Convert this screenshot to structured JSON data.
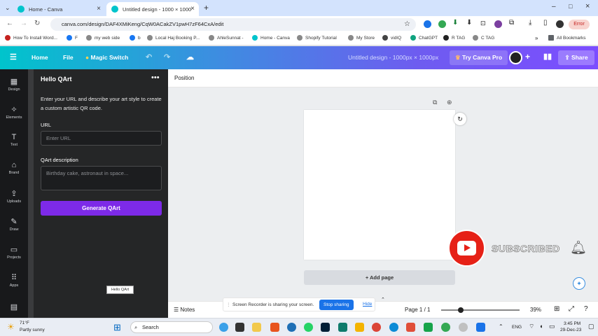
{
  "browser": {
    "tabs": [
      {
        "title": "Home - Canva",
        "active": false
      },
      {
        "title": "Untitled design - 1000 × 1000p",
        "active": true
      }
    ],
    "url": "canva.com/design/DAF4XMiKeng/CqW0ACakZV1pwH7zF64CxA/edit",
    "error_label": "Error",
    "bookmarks": [
      "How To Install Word...",
      "F",
      "my web side",
      "b",
      "Local Haj Booking P...",
      "AhleSunnat -",
      "Home - Canva",
      "Shopify Tutorial",
      "My Store",
      "vidIQ",
      "ChatGPT",
      "R TAG",
      "C TAG"
    ],
    "all_bookmarks": "All Bookmarks"
  },
  "canva": {
    "home": "Home",
    "file": "File",
    "magic_switch": "Magic Switch",
    "design_title": "Untitled design - 1000px × 1000px",
    "try_pro": "Try Canva Pro",
    "share": "Share"
  },
  "leftnav": [
    "Design",
    "Elements",
    "Text",
    "Brand",
    "Uploads",
    "Draw",
    "Projects",
    "Apps"
  ],
  "panel": {
    "title": "Hello QArt",
    "description": "Enter your URL and describe your art style to create a custom artistic QR code.",
    "url_label": "URL",
    "url_placeholder": "Enter URL",
    "desc_label": "QArt description",
    "desc_placeholder": "Birthday cake, astronaut in space...",
    "generate": "Generate QArt",
    "tooltip": "Hello QArt"
  },
  "workspace": {
    "position": "Position",
    "add_page": "+ Add page",
    "notes": "Notes",
    "page_indicator": "Page 1 / 1",
    "zoom": "39%",
    "zoom_level": 0.25
  },
  "share_bar": {
    "message": "Screen Recorder is sharing your screen.",
    "stop": "Stop sharing",
    "hide": "Hide"
  },
  "overlay": {
    "subscribed": "SUBSCRIBED"
  },
  "taskbar": {
    "temp": "71°F",
    "weather": "Partly sunny",
    "search": "Search",
    "lang": "ENG",
    "time": "3:45 PM",
    "date": "29-Dec-23"
  },
  "colors": {
    "accent": "#7d2ae8",
    "youtube": "#e62117"
  }
}
